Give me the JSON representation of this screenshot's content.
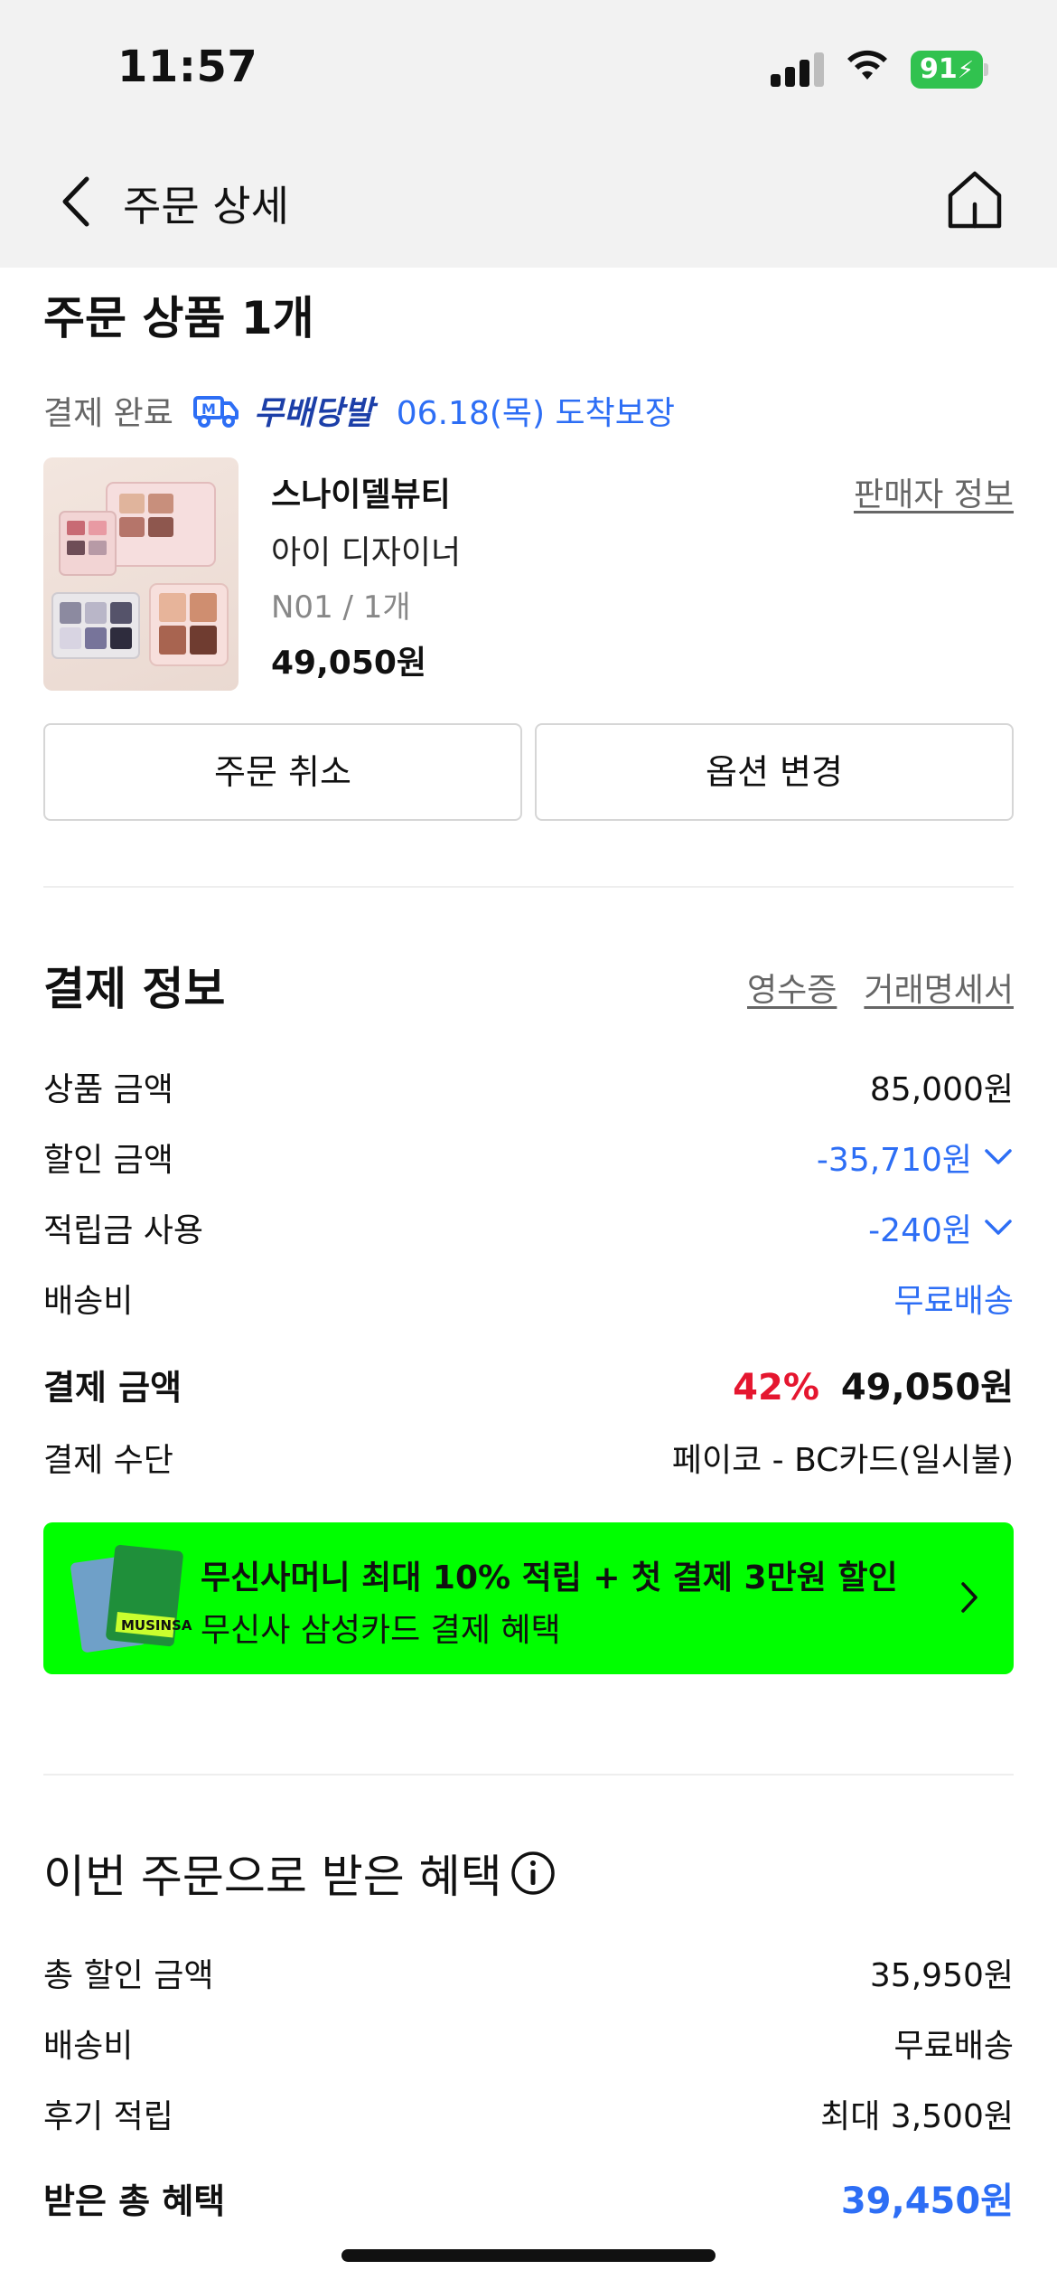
{
  "status_bar": {
    "time": "11:57",
    "battery": "91"
  },
  "nav": {
    "title": "주문 상세"
  },
  "order": {
    "heading": "주문 상품 1개",
    "status": "결제 완료",
    "delivery_badge": "무배당발",
    "delivery_guarantee": "06.18(목) 도착보장",
    "brand": "스나이델뷰티",
    "seller_info": "판매자 정보",
    "product_name": "아이 디자이너",
    "option": "N01 / 1개",
    "price": "49,050원",
    "cancel_label": "주문 취소",
    "change_option_label": "옵션 변경"
  },
  "payment": {
    "heading": "결제 정보",
    "receipt": "영수증",
    "statement": "거래명세서",
    "product_amount_label": "상품 금액",
    "product_amount": "85,000원",
    "discount_label": "할인 금액",
    "discount": "-35,710원",
    "points_label": "적립금 사용",
    "points": "-240원",
    "shipping_label": "배송비",
    "shipping": "무료배송",
    "total_label": "결제 금액",
    "total_percent": "42%",
    "total": "49,050원",
    "method_label": "결제 수단",
    "method": "페이코 - BC카드(일시불)"
  },
  "banner": {
    "line1": "무신사머니 최대 10% 적립 + 첫 결제 3만원 할인",
    "line2": "무신사 삼성카드 결제 혜택",
    "card_text": "MUSINSA",
    "color": "#00ff00"
  },
  "benefits": {
    "heading": "이번 주문으로 받은 혜택",
    "total_discount_label": "총 할인 금액",
    "total_discount": "35,950원",
    "shipping_label": "배송비",
    "shipping": "무료배송",
    "review_label": "후기 적립",
    "review": "최대 3,500원",
    "received_label": "받은 총 혜택",
    "received": "39,450원"
  },
  "colors": {
    "accent_blue": "#2d6ef5",
    "discount_red": "#e5162f",
    "nav_bg": "#f2f2f2"
  }
}
